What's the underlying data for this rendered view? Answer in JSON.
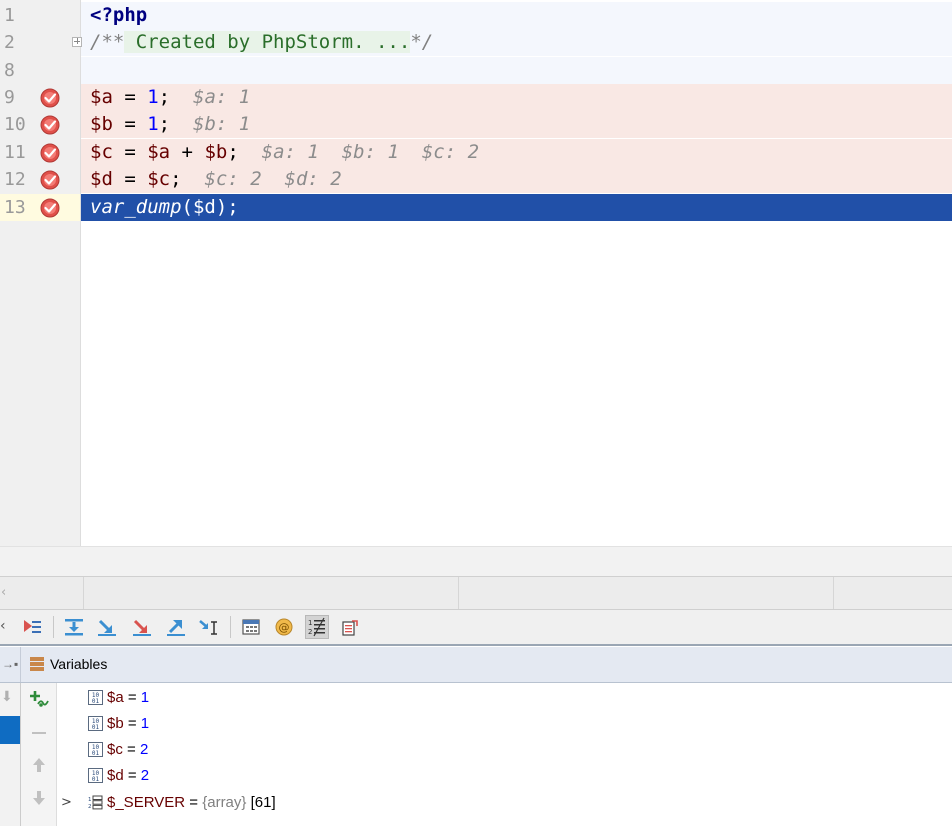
{
  "editor": {
    "line_numbers": [
      "1",
      "2",
      "8",
      "9",
      "10",
      "11",
      "12",
      "13"
    ],
    "php_open": "<?php",
    "doc_open": "/**",
    "doc_fold": " Created by PhpStorm. ...",
    "doc_close": "*/",
    "lines": [
      {
        "var": "$a",
        "eq": " = ",
        "num": "1",
        "semi": ";",
        "hint": "$a: 1"
      },
      {
        "var": "$b",
        "eq": " = ",
        "num": "1",
        "semi": ";",
        "hint": "$b: 1"
      },
      {
        "var1": "$c",
        "eq": " = ",
        "var2": "$a",
        "plus": " + ",
        "var3": "$b",
        "semi": ";",
        "hint": "$a: 1  $b: 1  $c: 2"
      },
      {
        "var1": "$d",
        "eq": " = ",
        "var2": "$c",
        "semi": ";",
        "hint": "$c: 2  $d: 2"
      }
    ],
    "current_line": {
      "fn": "var_dump",
      "open": "(",
      "arg": "$d",
      "close": ");"
    }
  },
  "debugger": {
    "variables_title": "Variables",
    "variables": [
      {
        "name": "$a",
        "eq": " = ",
        "value": "1"
      },
      {
        "name": "$b",
        "eq": " = ",
        "value": "1"
      },
      {
        "name": "$c",
        "eq": " = ",
        "value": "2"
      },
      {
        "name": "$d",
        "eq": " = ",
        "value": "2"
      }
    ],
    "server": {
      "name": "$_SERVER",
      "eq": " = ",
      "type": "{array}",
      "size": " [61]"
    }
  },
  "colors": {
    "selection": "#2150a8",
    "breakpoint_line": "#f9e8e4",
    "breakpoint_icon": "#e0504a",
    "keyword": "#000080",
    "variable": "#660000",
    "number": "#0000ff",
    "inline_hint": "#8c8c8c"
  },
  "icons": {
    "breakpoint": "breakpoint-check-icon",
    "toolbar": [
      "show-execution-point-icon",
      "step-over-icon",
      "step-into-icon",
      "force-step-into-icon",
      "step-out-icon",
      "run-to-cursor-icon",
      "evaluate-expression-icon",
      "watch-icon",
      "frames-order-icon",
      "restore-layout-icon"
    ]
  }
}
